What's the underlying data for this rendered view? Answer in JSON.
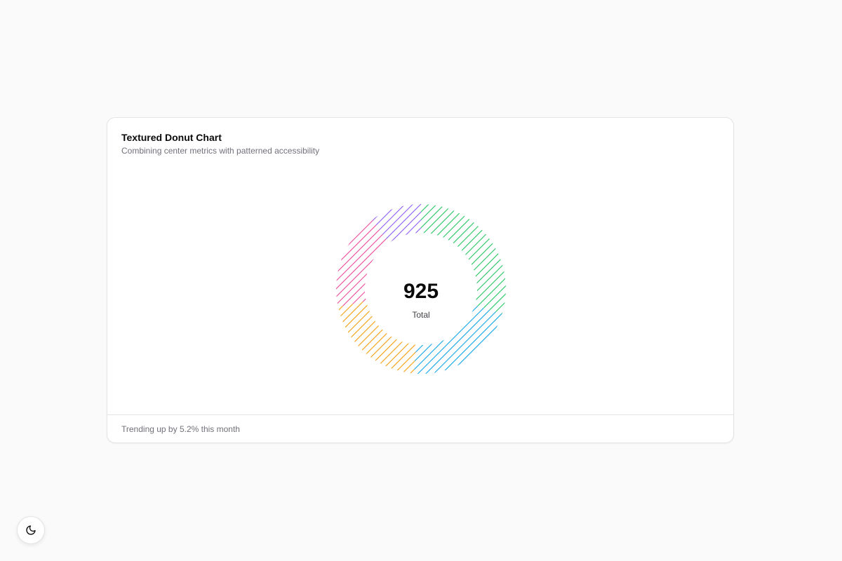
{
  "card": {
    "title": "Textured Donut Chart",
    "subtitle": "Combining center metrics with patterned accessibility",
    "footer": "Trending up by 5.2% this month"
  },
  "center": {
    "value": "925",
    "label": "Total"
  },
  "theme_toggle": {
    "icon": "moon-icon"
  },
  "chart_data": {
    "type": "pie",
    "variant": "donut",
    "pattern": "diagonal-stripes",
    "total": 925,
    "slices": [
      {
        "value": 275,
        "color": "#22c55e"
      },
      {
        "value": 200,
        "color": "#0ea5e9"
      },
      {
        "value": 187,
        "color": "#f59e0b"
      },
      {
        "value": 173,
        "color": "#ec4899"
      },
      {
        "value": 90,
        "color": "#8b5cf6"
      }
    ]
  }
}
